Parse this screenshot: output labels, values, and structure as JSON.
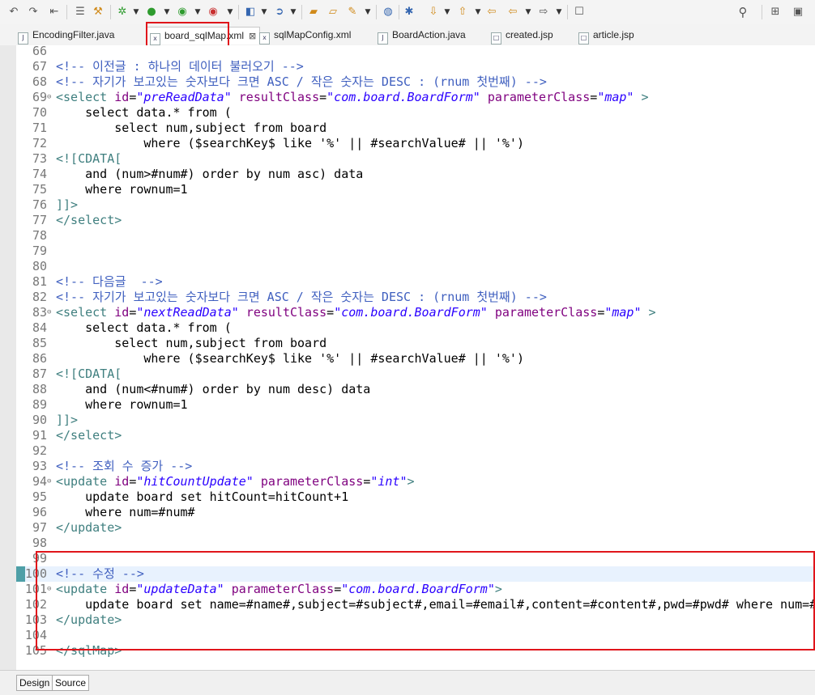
{
  "toolbar": {
    "icons": [
      "undo-icon",
      "redo-icon",
      "format-icon",
      "list-icon",
      "tools-icon",
      "debug-icon",
      "run-icon",
      "run-server-icon",
      "stop-icon",
      "new-file-icon",
      "refresh-icon",
      "open-folder-icon",
      "folder-icon",
      "build-icon",
      "globe-icon",
      "search-files-icon",
      "next-annotation-icon",
      "previous-annotation-icon",
      "back-icon",
      "forward-icon",
      "new-window-icon",
      "search-icon",
      "perspective-icon"
    ]
  },
  "tabs": [
    {
      "label": "EncodingFilter.java",
      "icon": "J"
    },
    {
      "label": "board_sqlMap.xml",
      "icon": "x",
      "active": true
    },
    {
      "label": "sqlMapConfig.xml",
      "icon": "x"
    },
    {
      "label": "BoardAction.java",
      "icon": "J"
    },
    {
      "label": "created.jsp",
      "icon": "□"
    },
    {
      "label": "article.jsp",
      "icon": "□"
    }
  ],
  "lines": [
    {
      "n": "66",
      "code": ""
    },
    {
      "n": "67",
      "code": "<!-- 이전글 : 하나의 데이터 불러오기 -->"
    },
    {
      "n": "68",
      "code": "<!-- 자기가 보고있는 숫자보다 크면 ASC / 작은 숫자는 DESC : (rnum 첫번째) -->"
    },
    {
      "n": "69",
      "code": "<select id=\"preReadData\" resultClass=\"com.board.BoardForm\" parameterClass=\"map\" >",
      "fold": true
    },
    {
      "n": "70",
      "code": "    select data.* from ("
    },
    {
      "n": "71",
      "code": "        select num,subject from board"
    },
    {
      "n": "72",
      "code": "            where ($searchKey$ like '%' || #searchValue# || '%')"
    },
    {
      "n": "73",
      "code": "<![CDATA["
    },
    {
      "n": "74",
      "code": "    and (num>#num#) order by num asc) data"
    },
    {
      "n": "75",
      "code": "    where rownum=1"
    },
    {
      "n": "76",
      "code": "]]>"
    },
    {
      "n": "77",
      "code": "</select>"
    },
    {
      "n": "78",
      "code": ""
    },
    {
      "n": "79",
      "code": ""
    },
    {
      "n": "80",
      "code": ""
    },
    {
      "n": "81",
      "code": "<!-- 다음글  -->"
    },
    {
      "n": "82",
      "code": "<!-- 자기가 보고있는 숫자보다 크면 ASC / 작은 숫자는 DESC : (rnum 첫번째) -->"
    },
    {
      "n": "83",
      "code": "<select id=\"nextReadData\" resultClass=\"com.board.BoardForm\" parameterClass=\"map\" >",
      "fold": true
    },
    {
      "n": "84",
      "code": "    select data.* from ("
    },
    {
      "n": "85",
      "code": "        select num,subject from board"
    },
    {
      "n": "86",
      "code": "            where ($searchKey$ like '%' || #searchValue# || '%')"
    },
    {
      "n": "87",
      "code": "<![CDATA["
    },
    {
      "n": "88",
      "code": "    and (num<#num#) order by num desc) data"
    },
    {
      "n": "89",
      "code": "    where rownum=1"
    },
    {
      "n": "90",
      "code": "]]>"
    },
    {
      "n": "91",
      "code": "</select>"
    },
    {
      "n": "92",
      "code": ""
    },
    {
      "n": "93",
      "code": "<!-- 조회 수 증가 -->"
    },
    {
      "n": "94",
      "code": "<update id=\"hitCountUpdate\" parameterClass=\"int\">",
      "fold": true
    },
    {
      "n": "95",
      "code": "    update board set hitCount=hitCount+1"
    },
    {
      "n": "96",
      "code": "    where num=#num#"
    },
    {
      "n": "97",
      "code": "</update>"
    },
    {
      "n": "98",
      "code": ""
    },
    {
      "n": "99",
      "code": ""
    },
    {
      "n": "100",
      "code": "<!-- 수정 -->",
      "current": true
    },
    {
      "n": "101",
      "code": "<update id=\"updateData\" parameterClass=\"com.board.BoardForm\">",
      "fold": true
    },
    {
      "n": "102",
      "code": "    update board set name=#name#,subject=#subject#,email=#email#,content=#content#,pwd=#pwd# where num=#"
    },
    {
      "n": "103",
      "code": "</update>"
    },
    {
      "n": "104",
      "code": ""
    },
    {
      "n": "105",
      "code": "</sqlMap>"
    }
  ],
  "bottom_tabs": [
    {
      "label": "Design"
    },
    {
      "label": "Source",
      "active": true
    }
  ]
}
